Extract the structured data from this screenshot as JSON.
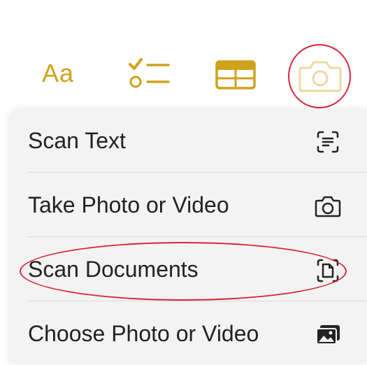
{
  "toolbar": {
    "format_label": "Aa",
    "accent_color": "#cfa21a",
    "icons": [
      "text-format-icon",
      "checklist-icon",
      "table-icon",
      "camera-icon"
    ]
  },
  "menu": {
    "items": [
      {
        "label": "Scan Text",
        "icon": "scan-text-icon"
      },
      {
        "label": "Take Photo or Video",
        "icon": "camera-icon"
      },
      {
        "label": "Scan Documents",
        "icon": "scan-document-icon"
      },
      {
        "label": "Choose Photo or Video",
        "icon": "photo-library-icon"
      }
    ]
  },
  "annotations": {
    "highlight_color": "#d6263a",
    "highlighted": [
      "camera-button",
      "scan-documents-item"
    ]
  }
}
